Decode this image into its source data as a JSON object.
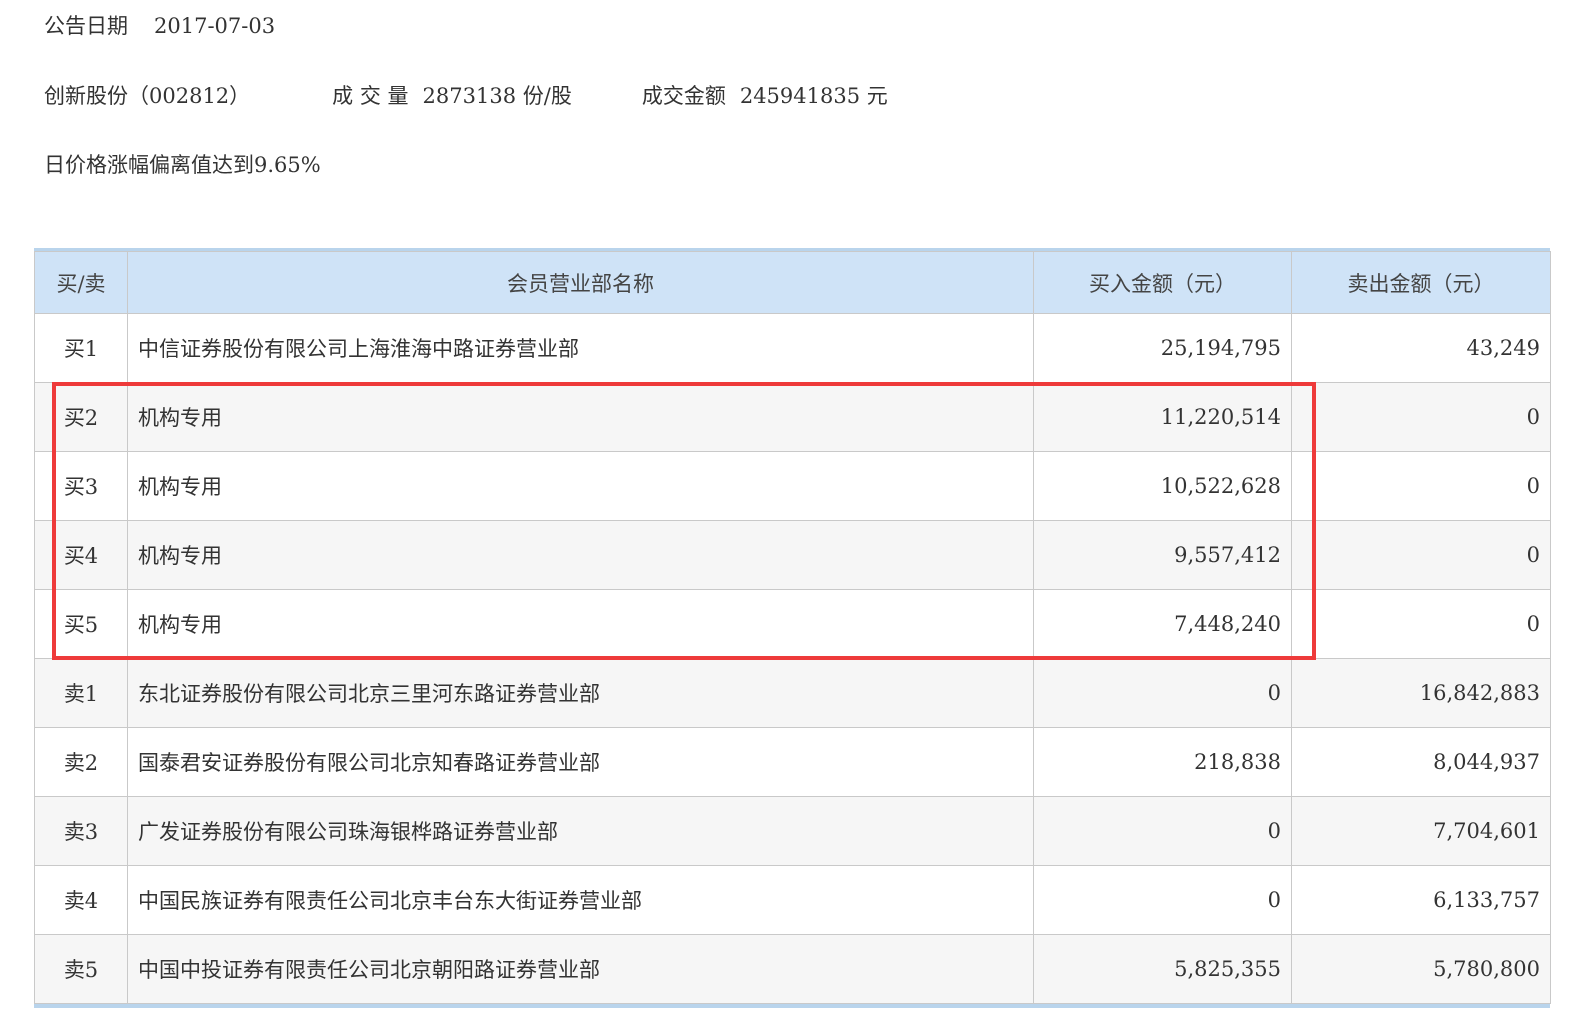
{
  "announcement": {
    "date_label": "公告日期",
    "date_value": "2017-07-03"
  },
  "stock": {
    "name_code": "创新股份（002812）",
    "volume_label": "成 交 量",
    "volume_value": "2873138",
    "volume_unit": "份/股",
    "amount_label": "成交金额",
    "amount_value": "245941835",
    "amount_unit": "元"
  },
  "reason": "日价格涨幅偏离值达到9.65%",
  "table": {
    "headers": [
      "买/卖",
      "会员营业部名称",
      "买入金额（元）",
      "卖出金额（元）"
    ],
    "rows": [
      {
        "side": "买1",
        "name": "中信证券股份有限公司上海淮海中路证券营业部",
        "buy": "25,194,795",
        "sell": "43,249"
      },
      {
        "side": "买2",
        "name": "机构专用",
        "buy": "11,220,514",
        "sell": "0"
      },
      {
        "side": "买3",
        "name": "机构专用",
        "buy": "10,522,628",
        "sell": "0"
      },
      {
        "side": "买4",
        "name": "机构专用",
        "buy": "9,557,412",
        "sell": "0"
      },
      {
        "side": "买5",
        "name": "机构专用",
        "buy": "7,448,240",
        "sell": "0"
      },
      {
        "side": "卖1",
        "name": "东北证券股份有限公司北京三里河东路证券营业部",
        "buy": "0",
        "sell": "16,842,883"
      },
      {
        "side": "卖2",
        "name": "国泰君安证券股份有限公司北京知春路证券营业部",
        "buy": "218,838",
        "sell": "8,044,937"
      },
      {
        "side": "卖3",
        "name": "广发证券股份有限公司珠海银桦路证券营业部",
        "buy": "0",
        "sell": "7,704,601"
      },
      {
        "side": "卖4",
        "name": "中国民族证券有限责任公司北京丰台东大街证券营业部",
        "buy": "0",
        "sell": "6,133,757"
      },
      {
        "side": "卖5",
        "name": "中国中投证券有限责任公司北京朝阳路证券营业部",
        "buy": "5,825,355",
        "sell": "5,780,800"
      }
    ]
  },
  "colors": {
    "header_bg": "#cfe3f7",
    "highlight_border": "#ee3a3a",
    "text": "#333333"
  }
}
